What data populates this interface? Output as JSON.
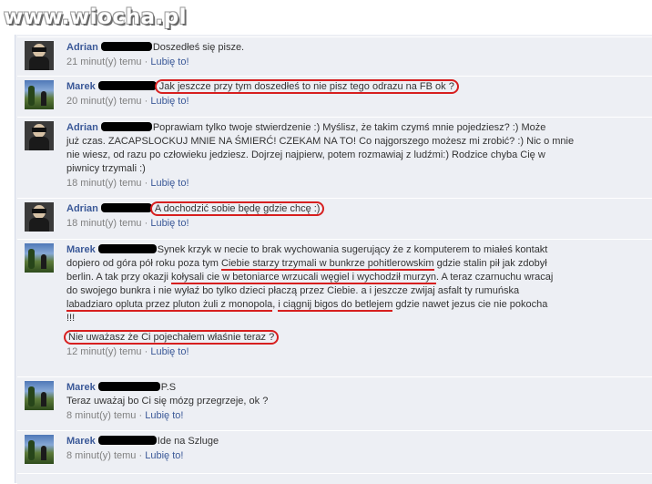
{
  "site": {
    "logo": "www.wiocha.pl"
  },
  "comments": [
    {
      "author": "Adrian",
      "text": "Doszedłeś się pisze.",
      "time": "21 minut(y) temu",
      "sep": "·",
      "like": "Lubię to!"
    },
    {
      "author": "Marek",
      "text": "Jak jeszcze przy tym doszedłeś to nie pisz tego odrazu na FB ok ?",
      "time": "20 minut(y) temu",
      "sep": "·",
      "like": "Lubię to!"
    },
    {
      "author": "Adrian",
      "line1": "Poprawiam tylko twoje stwierdzenie :) Myślisz, że takim czymś mnie pojedziesz? :) Może",
      "line2": "już czas. ZACAPSLOCKUJ MNIE NA ŚMIERĆ! CZEKAM NA TO! Co najgorszego możesz mi zrobić? :) Nic o mnie",
      "line3": "nie wiesz, od razu po człowieku jedziesz. Dojrzej najpierw, potem rozmawiaj z ludźmi:) Rodzice chyba Cię w",
      "line4": "piwnicy trzymali :)",
      "time": "18 minut(y) temu",
      "sep": "·",
      "like": "Lubię to!"
    },
    {
      "author": "Adrian",
      "text": "A dochodzić sobie będę gdzie chcę :)",
      "time": "18 minut(y) temu",
      "sep": "·",
      "like": "Lubię to!"
    },
    {
      "author": "Marek",
      "line1": "Synek krzyk w necie to brak wychowania sugerujący że z komputerem to miałeś kontakt",
      "line2a": "dopiero od góra pół roku poza tym ",
      "line2b": "Ciebie starzy trzymali w bunkrze pohitlerowskim",
      "line2c": " gdzie stalin pił jak zdobył",
      "line3a": "berlin. A tak przy okazji ",
      "line3b": "kołysali cie w betoniarce wrzucali węgiel i wychodził murzyn",
      "line3c": ". A teraz czarnuchu wracaj",
      "line4": "do swojego bunkra i nie wyłaź bo tylko dzieci płaczą przez Ciebie. a i jeszcze zwijaj asfalt ty rumuńska",
      "line5a": "labadziaro opluta przez pluton żuli z monopola",
      "line5b": ", ",
      "line5c": "i ciągnij bigos do betlejem",
      "line5d": " gdzie nawet jezus cie nie pokocha",
      "line6": "!!!",
      "line7": "Nie uważasz że Ci pojechałem właśnie teraz ?",
      "time": "12 minut(y) temu",
      "sep": "·",
      "like": "Lubię to!"
    },
    {
      "author": "Marek",
      "line1": "P.S",
      "line2": "Teraz uważaj bo Ci się mózg przegrzeje, ok ?",
      "time": "8 minut(y) temu",
      "sep": "·",
      "like": "Lubię to!"
    },
    {
      "author": "Marek",
      "text": "Ide na Szluge",
      "time": "8 minut(y) temu",
      "sep": "·",
      "like": "Lubię to!"
    }
  ]
}
